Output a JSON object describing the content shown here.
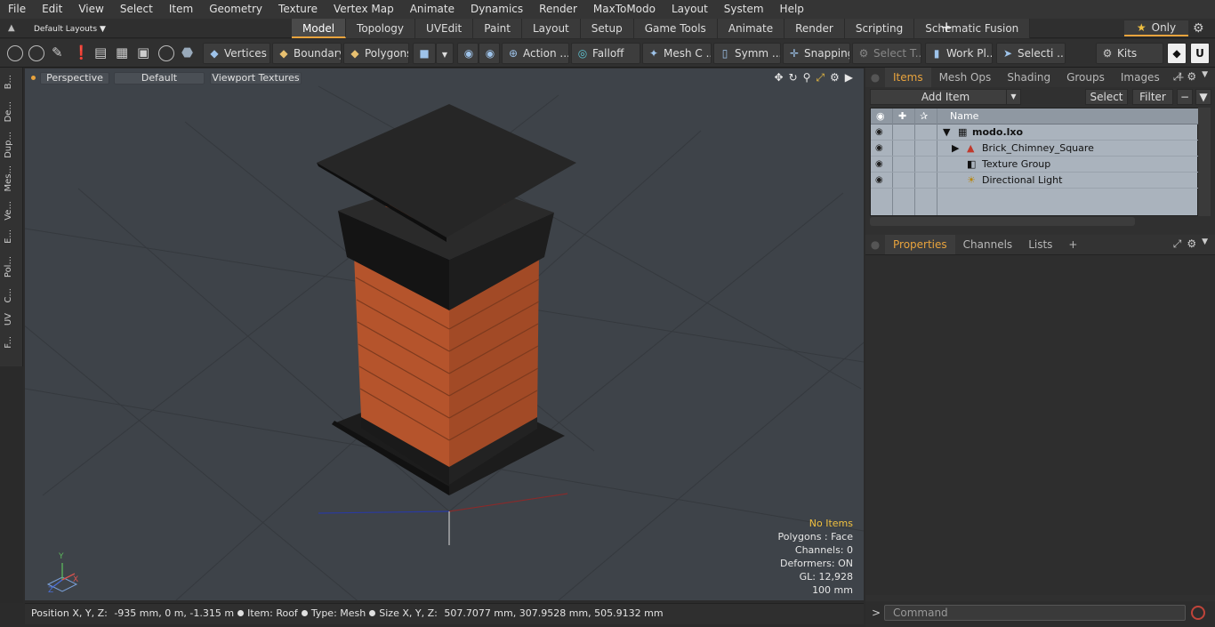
{
  "menu": [
    "File",
    "Edit",
    "View",
    "Select",
    "Item",
    "Geometry",
    "Texture",
    "Vertex Map",
    "Animate",
    "Dynamics",
    "Render",
    "MaxToModo",
    "Layout",
    "System",
    "Help"
  ],
  "layout_selector": "Default Layouts",
  "layout_tabs": [
    "Model",
    "Topology",
    "UVEdit",
    "Paint",
    "Layout",
    "Setup",
    "Game Tools",
    "Animate",
    "Render",
    "Scripting",
    "Schematic Fusion"
  ],
  "active_tab": "Model",
  "only_label": "Only",
  "toolbar": {
    "vertices": "Vertices",
    "boundary": "Boundary",
    "polygons": "Polygons",
    "action": "Action ...",
    "falloff": "Falloff",
    "mesh": "Mesh C ...",
    "symm": "Symm ...",
    "snapping": "Snapping",
    "select_t": "Select T...",
    "work_pl": "Work Pl...",
    "selecti": "Selecti ...",
    "kits": "Kits"
  },
  "left_strip": [
    "B...",
    "De...",
    "Dup...",
    "Mes...",
    "Ve...",
    "E...",
    "Pol...",
    "C...",
    "UV",
    "F..."
  ],
  "viewport": {
    "perspective": "Perspective",
    "shading": "Default",
    "textures": "Viewport Textures",
    "axis_labels": {
      "y": "Y",
      "x": "X",
      "z": "Z"
    },
    "info": {
      "no_items": "No Items",
      "polygons": "Polygons : Face",
      "channels": "Channels: 0",
      "deformers": "Deformers: ON",
      "gl": "GL: 12,928",
      "grid": "100 mm"
    },
    "colors": {
      "bg": "#3e4349",
      "brick": "#b5542c",
      "cap": "#1b1b1b"
    }
  },
  "status": {
    "position_label": "Position X, Y, Z:",
    "position_value": "-935 mm, 0 m, -1.315 m",
    "item_label": "Item:",
    "item_value": "Roof",
    "type_label": "Type:",
    "type_value": "Mesh",
    "size_label": "Size X, Y, Z:",
    "size_value": "507.7077 mm, 307.9528 mm, 505.9132 mm"
  },
  "items_panel": {
    "tabs": [
      "Items",
      "Mesh Ops",
      "Shading",
      "Groups",
      "Images"
    ],
    "active": "Items",
    "add_item": "Add Item",
    "select": "Select",
    "filter": "Filter",
    "column_name": "Name",
    "tree": [
      {
        "label": "modo.lxo",
        "icon": "scene-icon",
        "bold": true
      },
      {
        "label": "Brick_Chimney_Square",
        "icon": "mesh-icon",
        "bold": false
      },
      {
        "label": "Texture Group",
        "icon": "texture-icon",
        "bold": false
      },
      {
        "label": "Directional Light",
        "icon": "light-icon",
        "bold": false
      }
    ]
  },
  "props_panel": {
    "tabs": [
      "Properties",
      "Channels",
      "Lists"
    ],
    "active": "Properties"
  },
  "command": {
    "placeholder": "Command"
  }
}
